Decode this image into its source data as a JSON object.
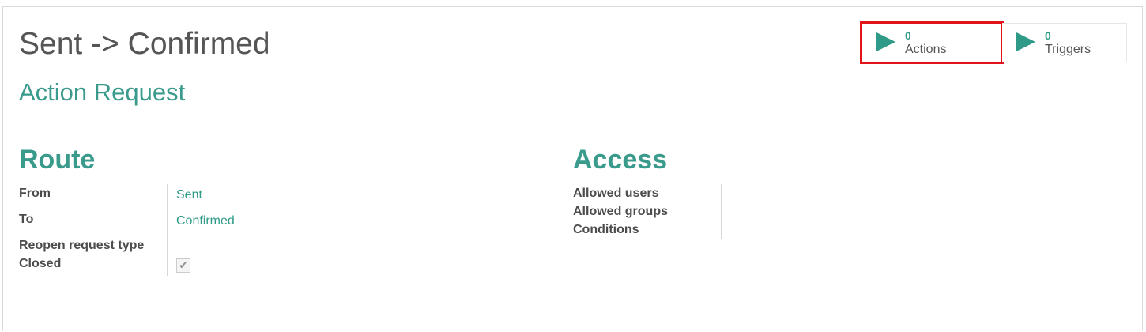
{
  "record": {
    "title": "Sent -> Confirmed",
    "subtitle": "Action Request"
  },
  "smart_buttons": [
    {
      "count": "0",
      "label": "Actions",
      "icon": "play-icon"
    },
    {
      "count": "0",
      "label": "Triggers",
      "icon": "play-icon"
    }
  ],
  "route": {
    "heading": "Route",
    "from_label": "From",
    "from_value": "Sent",
    "to_label": "To",
    "to_value": "Confirmed",
    "reopen_label": "Reopen request type",
    "closed_label": "Closed",
    "closed_checked": true,
    "check_glyph": "✔"
  },
  "access": {
    "heading": "Access",
    "allowed_users_label": "Allowed users",
    "allowed_groups_label": "Allowed groups",
    "conditions_label": "Conditions"
  },
  "colors": {
    "accent": "#2f9a87",
    "highlight": "#e0141a"
  }
}
